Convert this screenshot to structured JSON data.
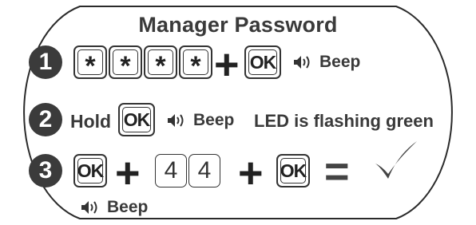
{
  "title": "Manager Password",
  "steps": [
    {
      "number": "1",
      "keys": [
        "*",
        "*",
        "*",
        "*"
      ],
      "plus": "+",
      "ok": "OK",
      "beep": "Beep"
    },
    {
      "number": "2",
      "hold": "Hold",
      "ok": "OK",
      "beep": "Beep",
      "led": "LED is flashing green"
    },
    {
      "number": "3",
      "ok1": "OK",
      "plus1": "+",
      "digits": [
        "4",
        "4"
      ],
      "plus2": "+",
      "ok2": "OK",
      "equals": "=",
      "beep": "Beep"
    }
  ],
  "icons": {
    "speaker": "speaker-icon",
    "check": "checkmark-icon"
  },
  "colors": {
    "badge": "#3b3b3b",
    "text": "#3a3a3a",
    "border": "#333333"
  }
}
